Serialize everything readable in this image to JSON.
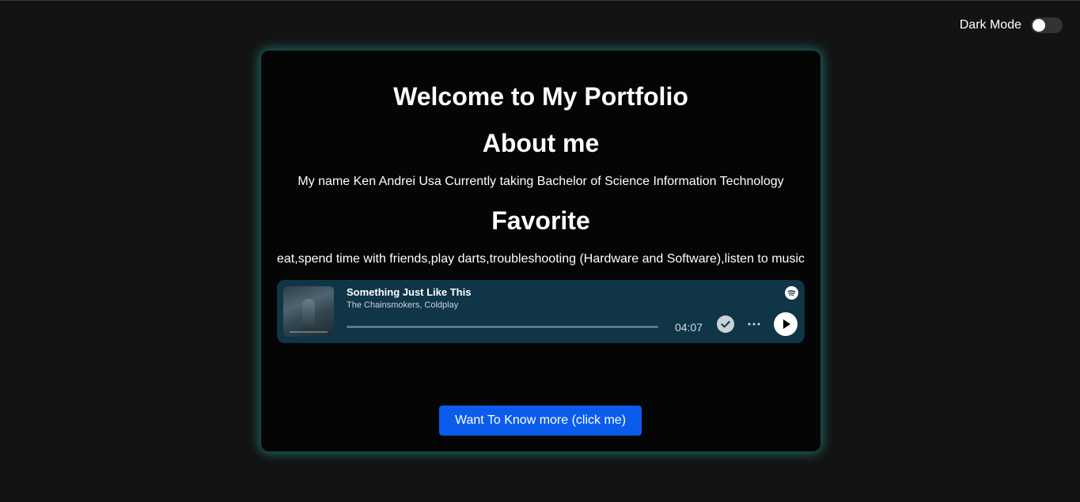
{
  "header": {
    "dark_mode_label": "Dark Mode",
    "dark_mode_on": false
  },
  "card": {
    "title": "Welcome to My Portfolio",
    "about_heading": "About me",
    "about_text": "My name Ken Andrei Usa Currently taking Bachelor of Science Information Technology",
    "favorite_heading": "Favorite",
    "favorite_text": "eat,spend time with friends,play darts,troubleshooting (Hardware and Software),listen to music",
    "cta_label": "Want To Know more (click me)"
  },
  "player": {
    "track_title": "Something Just Like This",
    "artist": "The Chainsmokers, Coldplay",
    "duration": "04:07",
    "progress": 0,
    "saved": true,
    "icons": [
      "album-art",
      "spotify-icon",
      "saved-check-icon",
      "more-icon",
      "play-icon"
    ]
  },
  "colors": {
    "page_background": "#131313",
    "card_background": "#050505",
    "card_glow": "#28aaa0",
    "player_background": "#0f3547",
    "button_blue": "#0b5ced",
    "text": "#ffffff"
  }
}
